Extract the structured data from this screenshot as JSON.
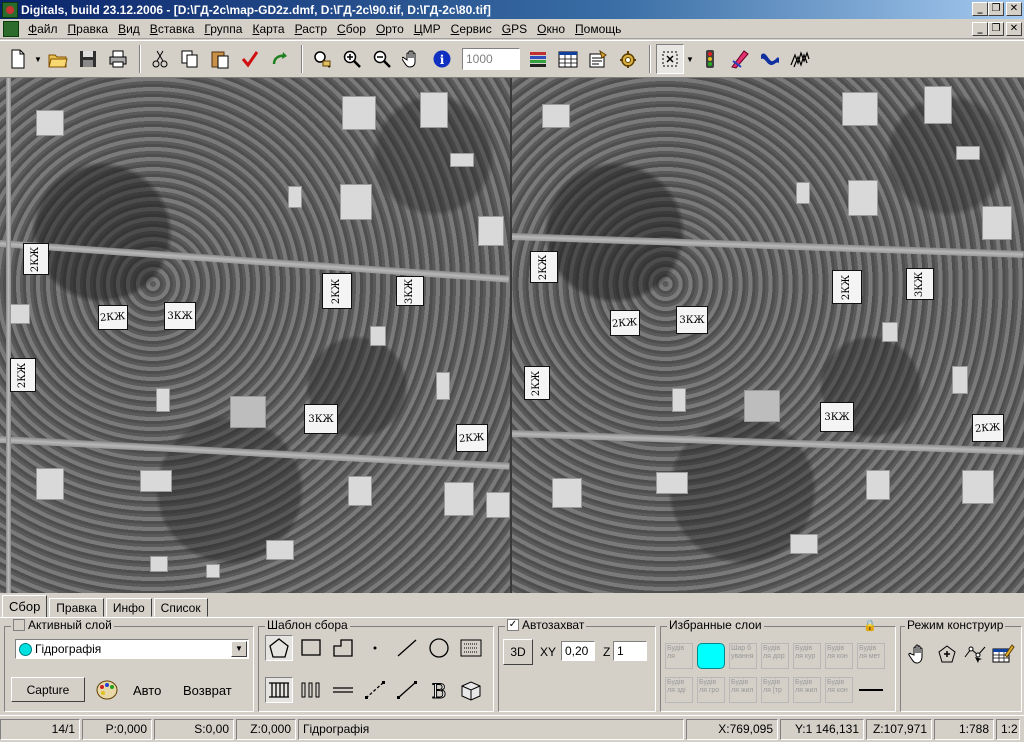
{
  "window": {
    "title": "Digitals, build 23.12.2006 - [D:\\ГД-2с\\map-GD2z.dmf, D:\\ГД-2с\\90.tif, D:\\ГД-2с\\80.tif]",
    "buttons": {
      "minimize": "_",
      "restore": "❐",
      "close": "✕"
    }
  },
  "menu": {
    "items": [
      "Файл",
      "Правка",
      "Вид",
      "Вставка",
      "Группа",
      "Карта",
      "Растр",
      "Сбор",
      "Орто",
      "ЦМР",
      "Сервис",
      "GPS",
      "Окно",
      "Помощь"
    ]
  },
  "toolbar": {
    "scale_value": "1000",
    "icons": [
      "new-document-icon",
      "open-folder-icon",
      "save-icon",
      "print-icon",
      "cut-icon",
      "copy-icon",
      "paste-icon",
      "check-icon",
      "redo-icon",
      "zoom-region-icon",
      "zoom-in-icon",
      "zoom-out-icon",
      "pan-hand-icon",
      "info-icon",
      "layers-icon",
      "table-icon",
      "properties-icon",
      "settings-icon",
      "select-tool-icon",
      "traffic-light-icon",
      "brush-icon",
      "curve-icon",
      "snap-icon"
    ]
  },
  "imagery": {
    "left_labels": [
      "2КЖ",
      "2КЖ",
      "3КЖ",
      "2КЖ",
      "3КЖ",
      "2КЖ",
      "3КЖ",
      "2КЖ"
    ],
    "right_labels": [
      "2КЖ",
      "2КЖ",
      "3КЖ",
      "2КЖ",
      "3КЖ",
      "2КЖ",
      "3КЖ",
      "2КЖ"
    ]
  },
  "tabs": [
    "Сбор",
    "Правка",
    "Инфо",
    "Список"
  ],
  "active_layer": {
    "title": "Активный слой",
    "selected": "Гідрографія",
    "swatch_color": "#00e0e0",
    "capture_label": "Capture",
    "auto_label": "Авто",
    "return_label": "Возврат"
  },
  "template": {
    "title": "Шаблон сбора",
    "tools": [
      "polygon-template-icon",
      "rectangle-template-icon",
      "stepped-polygon-icon",
      "point-template-icon",
      "line-template-icon",
      "circle-template-icon",
      "list-template-icon",
      "fence-template-icon",
      "triple-bar-icon",
      "dash-template-icon",
      "dashed-line-icon",
      "arrow-line-icon",
      "bold-b-icon",
      "cube-icon"
    ]
  },
  "autocapture": {
    "title": "Автозахват",
    "checked": "✓",
    "mode_3d": "3D",
    "xy_label": "XY",
    "xy_value": "0,20",
    "z_label": "Z",
    "z_value": "1"
  },
  "favorites": {
    "title": "Избранные слои",
    "items": [
      "Будів ля",
      "",
      "Шар б ування",
      "Будів ля дор",
      "Будів ля кур",
      "Будів ля кон",
      "Будів ля мет",
      "Будів ля зді",
      "Будів ля гро",
      "Будів ля жил",
      "Будів ля [тр",
      "Будів ля жил",
      "Будів ля кон",
      ""
    ]
  },
  "construct_mode": {
    "title": "Режим конструир",
    "tools": [
      "hand-cursor-icon",
      "add-vertex-icon",
      "edit-node-icon",
      "edit-table-icon"
    ]
  },
  "status": {
    "page": "14/1",
    "p": "P:0,000",
    "s": "S:0,00",
    "z": "Z:0,000",
    "layer": "Гідрографія",
    "x": "X:769,095",
    "y": "Y:1 146,131",
    "zc": "Z:107,971",
    "scale": "1:788",
    "ratio": "1:2"
  }
}
